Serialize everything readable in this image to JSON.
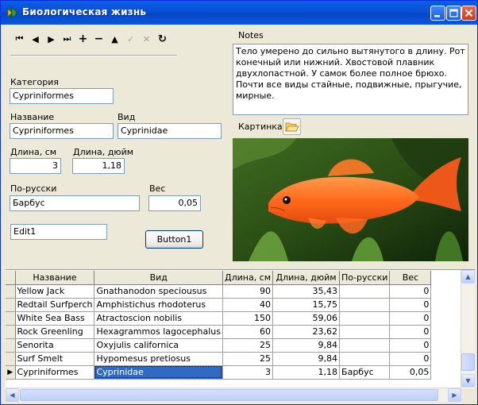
{
  "window": {
    "title": "Биологическая жизнь",
    "icon": "fish-app-icon",
    "controls": {
      "minimize": "minimize-icon",
      "maximize": "maximize-icon",
      "close": "close-icon"
    }
  },
  "navigator": {
    "buttons": [
      {
        "name": "first-record",
        "glyph": "⏮",
        "enabled": true
      },
      {
        "name": "prior-record",
        "glyph": "◀",
        "enabled": true
      },
      {
        "name": "next-record",
        "glyph": "▶",
        "enabled": true
      },
      {
        "name": "last-record",
        "glyph": "⏭",
        "enabled": true
      },
      {
        "name": "insert-record",
        "glyph": "+",
        "enabled": true
      },
      {
        "name": "delete-record",
        "glyph": "−",
        "enabled": true
      },
      {
        "name": "edit-record",
        "glyph": "▲",
        "enabled": true
      },
      {
        "name": "post-record",
        "glyph": "✓",
        "enabled": false
      },
      {
        "name": "cancel-edit",
        "glyph": "✕",
        "enabled": false
      },
      {
        "name": "refresh-data",
        "glyph": "↻",
        "enabled": true
      }
    ]
  },
  "form": {
    "category_label": "Категория",
    "category_value": "Cypriniformes",
    "name_label": "Название",
    "name_value": "Cypriniformes",
    "species_label": "Вид",
    "species_value": "Cyprinidae",
    "length_cm_label": "Длина, см",
    "length_cm_value": "3",
    "length_in_label": "Длина, дюйм",
    "length_in_value": "1,18",
    "russian_label": "По-русски",
    "russian_value": "Барбус",
    "weight_label": "Вес",
    "weight_value": "0,05",
    "edit1_value": "Edit1",
    "button1_label": "Button1"
  },
  "notes": {
    "label": "Notes",
    "text": "Тело умерено до сильно вытянутого в длину. Рот конечный или нижний. Хвостовой плавник двухлопастной. У самок более полное брюхо. Почти все виды стайные, подвижные, прыгучие, мирные."
  },
  "picture": {
    "label": "Картинка",
    "folder_icon": "folder-open-icon"
  },
  "grid": {
    "columns": [
      "Название",
      "Вид",
      "Длина, см",
      "Длина, дюйм",
      "По-русски",
      "Вес"
    ],
    "rows": [
      [
        "Yellow Jack",
        "Gnathanodon speciousus",
        "90",
        "35,43",
        "",
        "0"
      ],
      [
        "Redtail Surfperch",
        "Amphistichus rhodoterus",
        "40",
        "15,75",
        "",
        "0"
      ],
      [
        "White Sea Bass",
        "Atractoscion nobilis",
        "150",
        "59,06",
        "",
        "0"
      ],
      [
        "Rock Greenling",
        "Hexagrammos lagocephalus",
        "60",
        "23,62",
        "",
        "0"
      ],
      [
        "Senorita",
        "Oxyjulis californica",
        "25",
        "9,84",
        "",
        "0"
      ],
      [
        "Surf Smelt",
        "Hypomesus pretiosus",
        "25",
        "9,84",
        "",
        "0"
      ],
      [
        "Cypriniformes",
        "Cyprinidae",
        "3",
        "1,18",
        "Барбус",
        "0,05"
      ]
    ],
    "current_row_indicator": "▶"
  }
}
